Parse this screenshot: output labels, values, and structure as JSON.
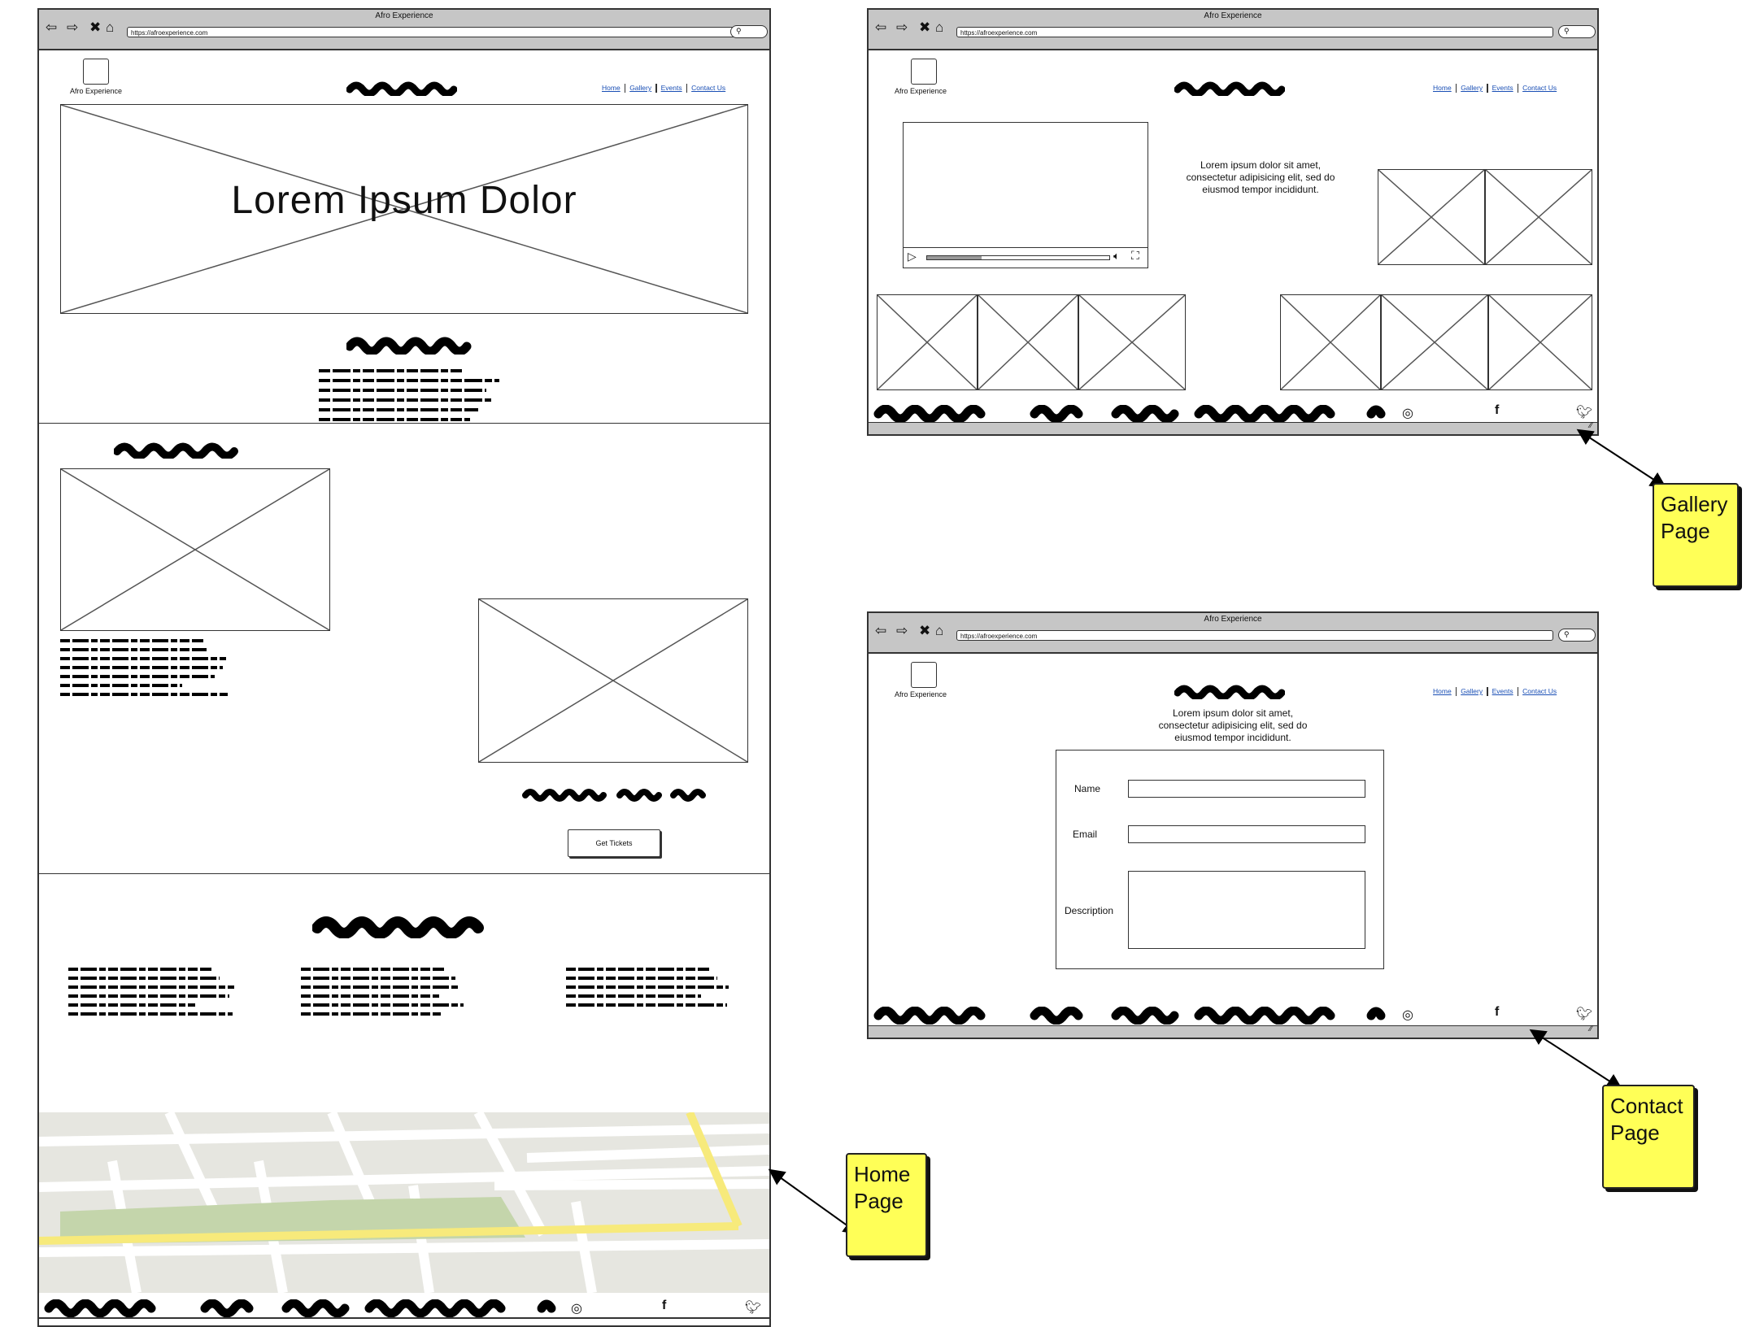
{
  "browser": {
    "title": "Afro Experience",
    "url": "https://afroexperience.com",
    "back_icon": "back-arrow-icon",
    "forward_icon": "forward-arrow-icon",
    "close_icon": "close-x-icon",
    "home_icon": "home-icon",
    "search_icon": "search-icon"
  },
  "site": {
    "logo_text": "Afro Experience",
    "nav": [
      "Home",
      "Gallery",
      "Events",
      "Contact Us"
    ]
  },
  "home": {
    "hero_text": "Lorem Ipsum Dolor",
    "button_label": "Get Tickets"
  },
  "gallery": {
    "lorem": "Lorem ipsum dolor sit amet, consectetur adipisicing elit, sed do eiusmod tempor incididunt."
  },
  "contact": {
    "lorem": "Lorem ipsum dolor sit amet, consectetur adipisicing elit, sed do eiusmod tempor incididunt.",
    "name_label": "Name",
    "email_label": "Email",
    "description_label": "Description"
  },
  "footer": {
    "social_icons": [
      "instagram-icon",
      "facebook-icon",
      "twitter-icon"
    ]
  },
  "notes": {
    "home": "Home Page",
    "gallery": "Gallery Page",
    "contact": "Contact Page"
  },
  "colors": {
    "chrome": "#c6c6c6",
    "note": "#ffff57",
    "link": "#1a4fb5",
    "map_bg": "#e6e6e0",
    "map_park": "#c4d5ab",
    "map_road": "#f7ea7b"
  }
}
